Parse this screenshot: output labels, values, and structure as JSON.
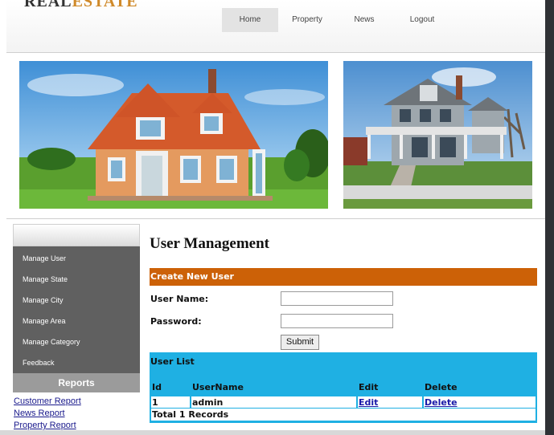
{
  "logo": {
    "part1": "REAL",
    "part2": "ESTATE"
  },
  "nav": [
    {
      "label": "Home",
      "active": true
    },
    {
      "label": "Property",
      "active": false
    },
    {
      "label": "News",
      "active": false
    },
    {
      "label": "Logout",
      "active": false
    }
  ],
  "sidebar": {
    "items": [
      {
        "label": "Manage User"
      },
      {
        "label": "Manage State"
      },
      {
        "label": "Manage City"
      },
      {
        "label": "Manage Area"
      },
      {
        "label": "Manage Category"
      },
      {
        "label": "Feedback"
      }
    ],
    "reports_heading": "Reports",
    "report_links": [
      {
        "label": "Customer Report"
      },
      {
        "label": "News Report"
      },
      {
        "label": "Property Report"
      }
    ]
  },
  "main": {
    "title": "User Management",
    "create_heading": "Create New User",
    "username_label": "User Name:",
    "username_value": "",
    "password_label": "Password:",
    "password_value": "",
    "submit_label": "Submit",
    "list_title": "User List",
    "columns": [
      "Id",
      "UserName",
      "Edit",
      "Delete"
    ],
    "rows": [
      {
        "id": "1",
        "username": "admin",
        "edit": "Edit",
        "delete": "Delete"
      }
    ],
    "total_text": "Total 1 Records"
  },
  "colors": {
    "create_bar": "#cc6107",
    "list_box": "#1fb0e3",
    "sidebar_bg": "#606060",
    "reports_bg": "#9b9b9b"
  }
}
